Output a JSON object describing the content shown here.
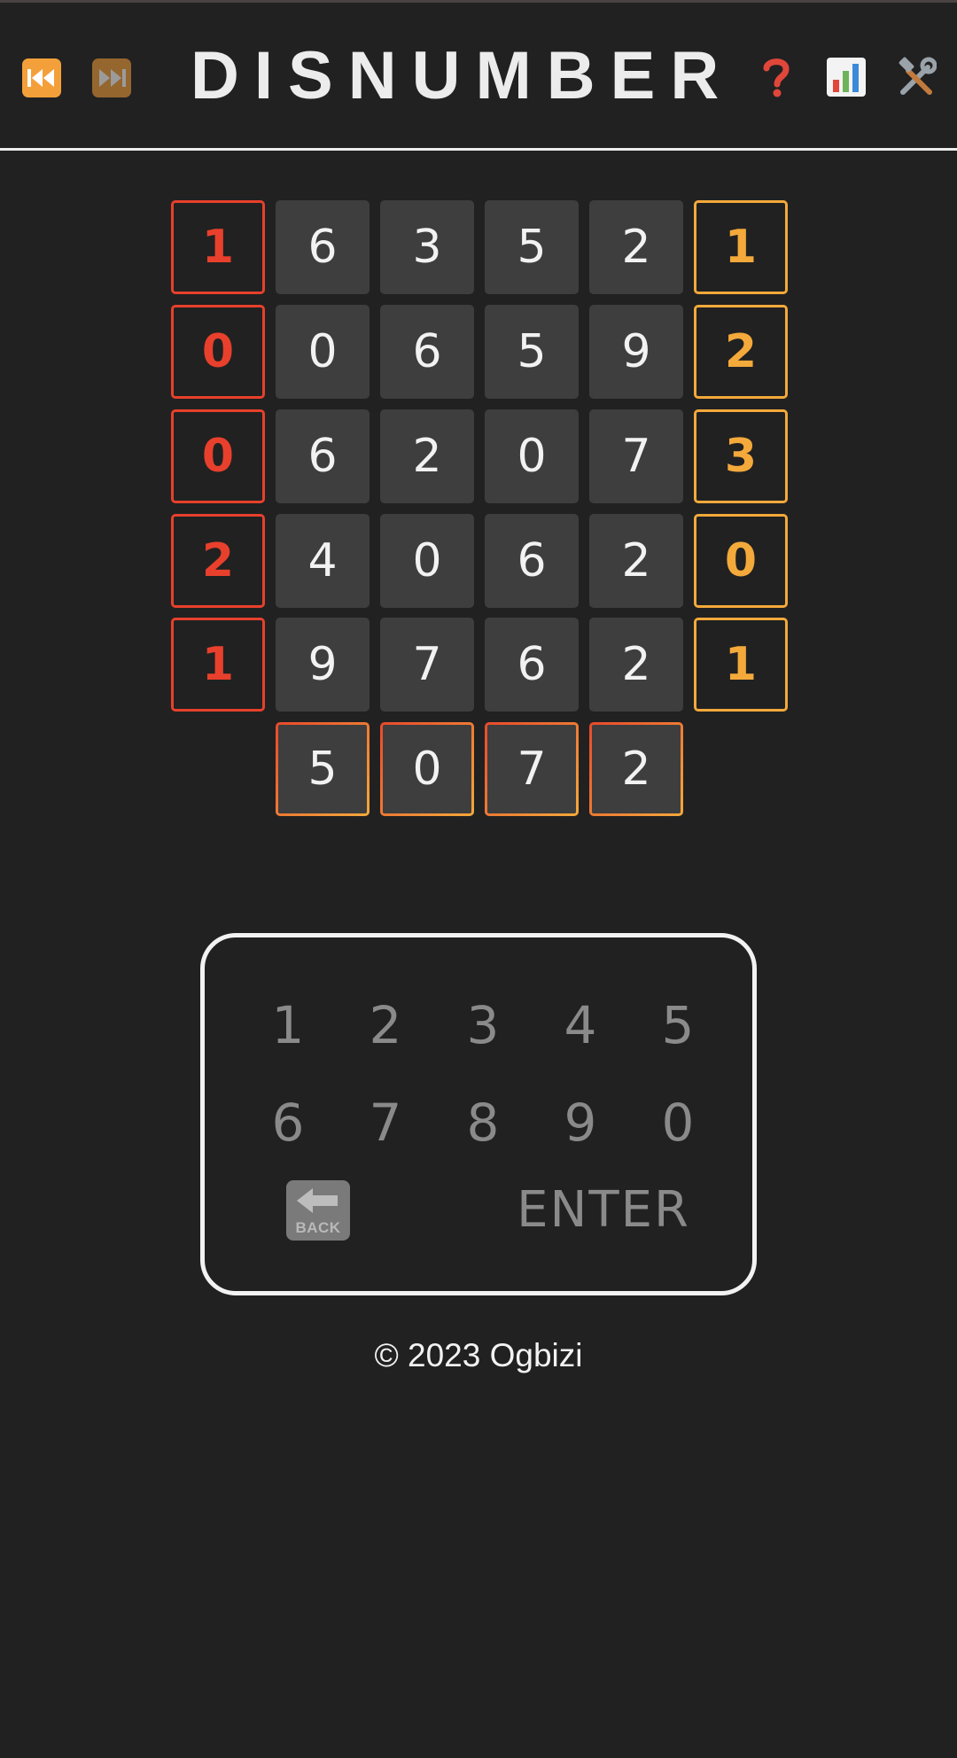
{
  "header": {
    "title": "DISNUMBER"
  },
  "board": {
    "left_clues": [
      "1",
      "0",
      "0",
      "2",
      "1"
    ],
    "rows": [
      [
        "6",
        "3",
        "5",
        "2"
      ],
      [
        "0",
        "6",
        "5",
        "9"
      ],
      [
        "6",
        "2",
        "0",
        "7"
      ],
      [
        "4",
        "0",
        "6",
        "2"
      ],
      [
        "9",
        "7",
        "6",
        "2"
      ]
    ],
    "right_clues": [
      "1",
      "2",
      "3",
      "0",
      "1"
    ],
    "current_guess": [
      "5",
      "0",
      "7",
      "2"
    ]
  },
  "keypad": {
    "row1": [
      "1",
      "2",
      "3",
      "4",
      "5"
    ],
    "row2": [
      "6",
      "7",
      "8",
      "9",
      "0"
    ],
    "back_label": "BACK",
    "enter_label": "ENTER"
  },
  "footer": {
    "copyright": "© 2023 Ogbizi"
  },
  "colors": {
    "background": "#212121",
    "cell": "#3e3e3e",
    "left_clue": "#e8402c",
    "right_clue": "#f4a93b",
    "nav_button": "#f4a03a"
  },
  "icons": {
    "prev": "rewind-icon",
    "next": "fast-forward-icon",
    "help": "question-mark-icon",
    "stats": "bar-chart-icon",
    "settings": "tools-icon",
    "back": "back-arrow-icon"
  }
}
